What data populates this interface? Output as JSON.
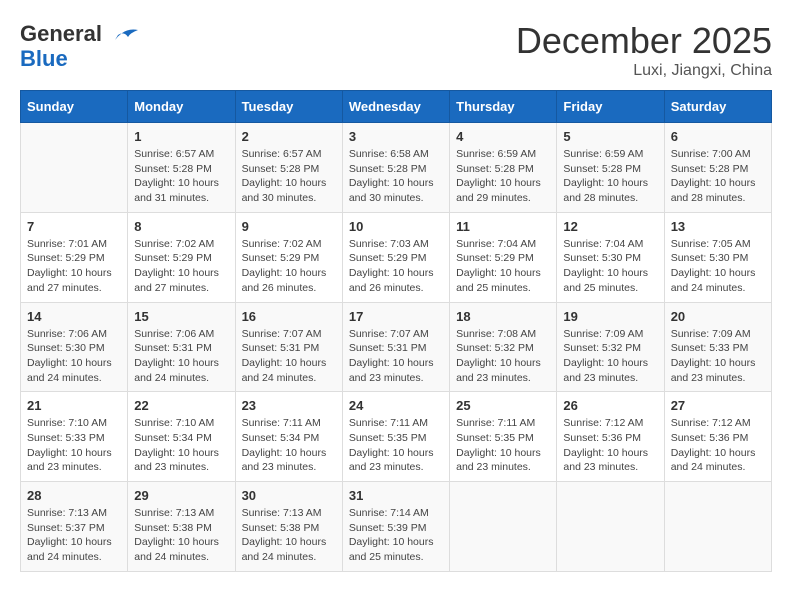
{
  "header": {
    "logo_line1": "General",
    "logo_line2": "Blue",
    "month_title": "December 2025",
    "location": "Luxi, Jiangxi, China"
  },
  "weekdays": [
    "Sunday",
    "Monday",
    "Tuesday",
    "Wednesday",
    "Thursday",
    "Friday",
    "Saturday"
  ],
  "weeks": [
    [
      {
        "day": "",
        "sunrise": "",
        "sunset": "",
        "daylight": ""
      },
      {
        "day": "1",
        "sunrise": "Sunrise: 6:57 AM",
        "sunset": "Sunset: 5:28 PM",
        "daylight": "Daylight: 10 hours and 31 minutes."
      },
      {
        "day": "2",
        "sunrise": "Sunrise: 6:57 AM",
        "sunset": "Sunset: 5:28 PM",
        "daylight": "Daylight: 10 hours and 30 minutes."
      },
      {
        "day": "3",
        "sunrise": "Sunrise: 6:58 AM",
        "sunset": "Sunset: 5:28 PM",
        "daylight": "Daylight: 10 hours and 30 minutes."
      },
      {
        "day": "4",
        "sunrise": "Sunrise: 6:59 AM",
        "sunset": "Sunset: 5:28 PM",
        "daylight": "Daylight: 10 hours and 29 minutes."
      },
      {
        "day": "5",
        "sunrise": "Sunrise: 6:59 AM",
        "sunset": "Sunset: 5:28 PM",
        "daylight": "Daylight: 10 hours and 28 minutes."
      },
      {
        "day": "6",
        "sunrise": "Sunrise: 7:00 AM",
        "sunset": "Sunset: 5:28 PM",
        "daylight": "Daylight: 10 hours and 28 minutes."
      }
    ],
    [
      {
        "day": "7",
        "sunrise": "Sunrise: 7:01 AM",
        "sunset": "Sunset: 5:29 PM",
        "daylight": "Daylight: 10 hours and 27 minutes."
      },
      {
        "day": "8",
        "sunrise": "Sunrise: 7:02 AM",
        "sunset": "Sunset: 5:29 PM",
        "daylight": "Daylight: 10 hours and 27 minutes."
      },
      {
        "day": "9",
        "sunrise": "Sunrise: 7:02 AM",
        "sunset": "Sunset: 5:29 PM",
        "daylight": "Daylight: 10 hours and 26 minutes."
      },
      {
        "day": "10",
        "sunrise": "Sunrise: 7:03 AM",
        "sunset": "Sunset: 5:29 PM",
        "daylight": "Daylight: 10 hours and 26 minutes."
      },
      {
        "day": "11",
        "sunrise": "Sunrise: 7:04 AM",
        "sunset": "Sunset: 5:29 PM",
        "daylight": "Daylight: 10 hours and 25 minutes."
      },
      {
        "day": "12",
        "sunrise": "Sunrise: 7:04 AM",
        "sunset": "Sunset: 5:30 PM",
        "daylight": "Daylight: 10 hours and 25 minutes."
      },
      {
        "day": "13",
        "sunrise": "Sunrise: 7:05 AM",
        "sunset": "Sunset: 5:30 PM",
        "daylight": "Daylight: 10 hours and 24 minutes."
      }
    ],
    [
      {
        "day": "14",
        "sunrise": "Sunrise: 7:06 AM",
        "sunset": "Sunset: 5:30 PM",
        "daylight": "Daylight: 10 hours and 24 minutes."
      },
      {
        "day": "15",
        "sunrise": "Sunrise: 7:06 AM",
        "sunset": "Sunset: 5:31 PM",
        "daylight": "Daylight: 10 hours and 24 minutes."
      },
      {
        "day": "16",
        "sunrise": "Sunrise: 7:07 AM",
        "sunset": "Sunset: 5:31 PM",
        "daylight": "Daylight: 10 hours and 24 minutes."
      },
      {
        "day": "17",
        "sunrise": "Sunrise: 7:07 AM",
        "sunset": "Sunset: 5:31 PM",
        "daylight": "Daylight: 10 hours and 23 minutes."
      },
      {
        "day": "18",
        "sunrise": "Sunrise: 7:08 AM",
        "sunset": "Sunset: 5:32 PM",
        "daylight": "Daylight: 10 hours and 23 minutes."
      },
      {
        "day": "19",
        "sunrise": "Sunrise: 7:09 AM",
        "sunset": "Sunset: 5:32 PM",
        "daylight": "Daylight: 10 hours and 23 minutes."
      },
      {
        "day": "20",
        "sunrise": "Sunrise: 7:09 AM",
        "sunset": "Sunset: 5:33 PM",
        "daylight": "Daylight: 10 hours and 23 minutes."
      }
    ],
    [
      {
        "day": "21",
        "sunrise": "Sunrise: 7:10 AM",
        "sunset": "Sunset: 5:33 PM",
        "daylight": "Daylight: 10 hours and 23 minutes."
      },
      {
        "day": "22",
        "sunrise": "Sunrise: 7:10 AM",
        "sunset": "Sunset: 5:34 PM",
        "daylight": "Daylight: 10 hours and 23 minutes."
      },
      {
        "day": "23",
        "sunrise": "Sunrise: 7:11 AM",
        "sunset": "Sunset: 5:34 PM",
        "daylight": "Daylight: 10 hours and 23 minutes."
      },
      {
        "day": "24",
        "sunrise": "Sunrise: 7:11 AM",
        "sunset": "Sunset: 5:35 PM",
        "daylight": "Daylight: 10 hours and 23 minutes."
      },
      {
        "day": "25",
        "sunrise": "Sunrise: 7:11 AM",
        "sunset": "Sunset: 5:35 PM",
        "daylight": "Daylight: 10 hours and 23 minutes."
      },
      {
        "day": "26",
        "sunrise": "Sunrise: 7:12 AM",
        "sunset": "Sunset: 5:36 PM",
        "daylight": "Daylight: 10 hours and 23 minutes."
      },
      {
        "day": "27",
        "sunrise": "Sunrise: 7:12 AM",
        "sunset": "Sunset: 5:36 PM",
        "daylight": "Daylight: 10 hours and 24 minutes."
      }
    ],
    [
      {
        "day": "28",
        "sunrise": "Sunrise: 7:13 AM",
        "sunset": "Sunset: 5:37 PM",
        "daylight": "Daylight: 10 hours and 24 minutes."
      },
      {
        "day": "29",
        "sunrise": "Sunrise: 7:13 AM",
        "sunset": "Sunset: 5:38 PM",
        "daylight": "Daylight: 10 hours and 24 minutes."
      },
      {
        "day": "30",
        "sunrise": "Sunrise: 7:13 AM",
        "sunset": "Sunset: 5:38 PM",
        "daylight": "Daylight: 10 hours and 24 minutes."
      },
      {
        "day": "31",
        "sunrise": "Sunrise: 7:14 AM",
        "sunset": "Sunset: 5:39 PM",
        "daylight": "Daylight: 10 hours and 25 minutes."
      },
      {
        "day": "",
        "sunrise": "",
        "sunset": "",
        "daylight": ""
      },
      {
        "day": "",
        "sunrise": "",
        "sunset": "",
        "daylight": ""
      },
      {
        "day": "",
        "sunrise": "",
        "sunset": "",
        "daylight": ""
      }
    ]
  ]
}
